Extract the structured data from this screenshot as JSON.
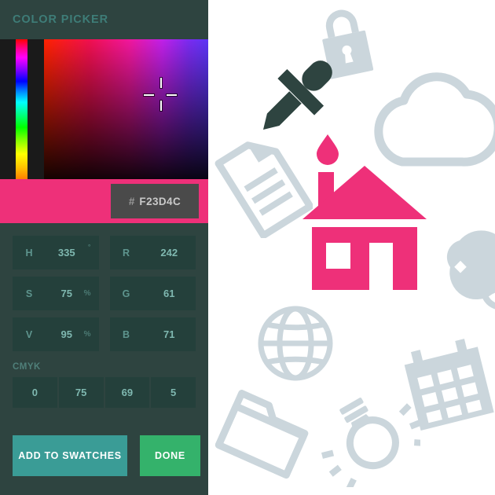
{
  "panel": {
    "title": "COLOR PICKER"
  },
  "swatch": {
    "hex_hash": "#",
    "hex_value": "F23D4C",
    "preview_color": "#EE3079"
  },
  "hsv_fields": [
    {
      "label": "H",
      "value": "335",
      "unit": "°"
    },
    {
      "label": "S",
      "value": "75",
      "unit": "%"
    },
    {
      "label": "V",
      "value": "95",
      "unit": "%"
    }
  ],
  "rgb_fields": [
    {
      "label": "R",
      "value": "242"
    },
    {
      "label": "G",
      "value": "61"
    },
    {
      "label": "B",
      "value": "71"
    }
  ],
  "cmyk": {
    "title": "CMYK",
    "values": [
      "0",
      "75",
      "69",
      "5"
    ]
  },
  "buttons": {
    "add_to_swatches": "ADD TO SWATCHES",
    "done": "DONE"
  },
  "illustration": {
    "icon_color": "#CBD6DC",
    "eyedropper_color": "#2E4440",
    "accent_color": "#EE3079",
    "icons": [
      "eyedropper-icon",
      "color-drop-icon",
      "padlock-icon",
      "cloud-icon",
      "document-icon",
      "house-icon",
      "globe-icon",
      "folder-icon",
      "lightbulb-icon",
      "calendar-icon",
      "palette-icon"
    ]
  }
}
